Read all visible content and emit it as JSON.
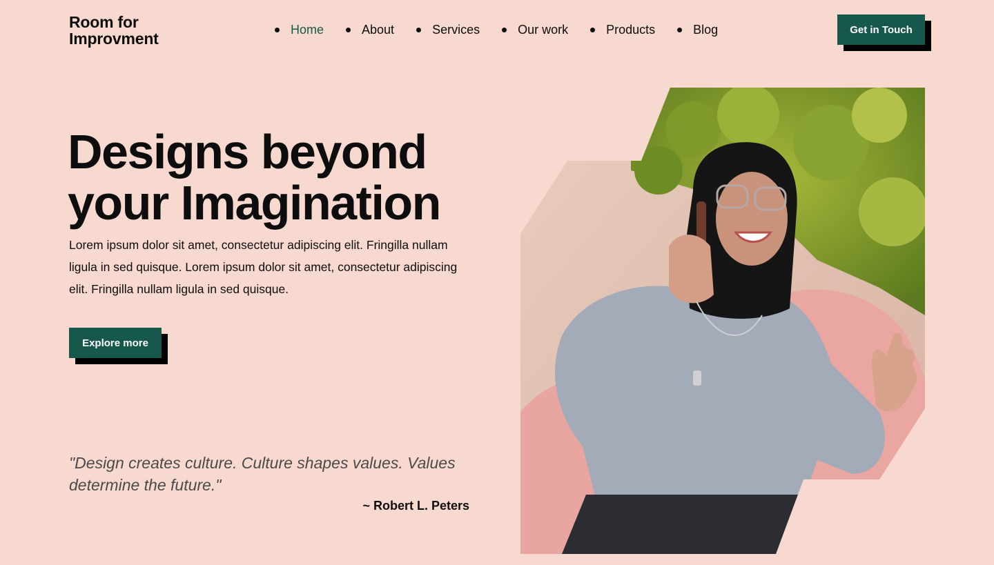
{
  "brand": {
    "name": "Room for\nImprovment"
  },
  "nav": {
    "items": [
      {
        "label": "Home",
        "active": true
      },
      {
        "label": "About",
        "active": false
      },
      {
        "label": "Services",
        "active": false
      },
      {
        "label": "Our work",
        "active": false
      },
      {
        "label": "Products",
        "active": false
      },
      {
        "label": "Blog",
        "active": false
      }
    ],
    "cta_label": "Get in Touch"
  },
  "hero": {
    "title": "Designs beyond\nyour Imagination",
    "text": "Lorem ipsum dolor sit amet, consectetur adipiscing elit. Fringilla nullam ligula in sed quisque. Lorem ipsum dolor sit amet, consectetur adipiscing elit. Fringilla nullam ligula in sed quisque.",
    "button_label": "Explore more"
  },
  "quote": {
    "text": "\"Design creates culture. Culture shapes values. Values determine the future.\"",
    "author": "~ Robert L. Peters"
  },
  "colors": {
    "background": "#f8d9cf",
    "accent": "#17584c",
    "text": "#0d0d0d"
  }
}
